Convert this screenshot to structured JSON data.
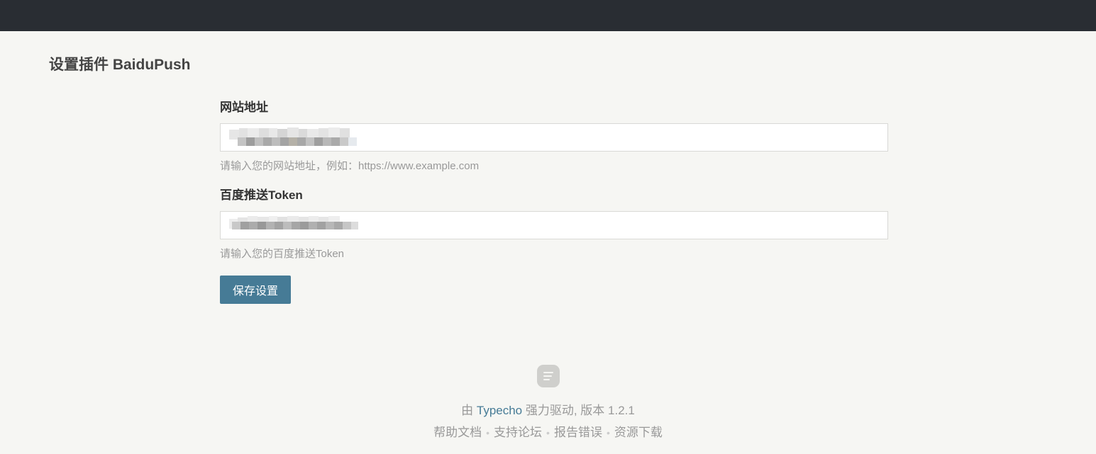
{
  "page_title": "设置插件 BaiduPush",
  "form": {
    "site_url": {
      "label": "网站地址",
      "value": "",
      "hint": "请输入您的网站地址，例如：https://www.example.com"
    },
    "token": {
      "label": "百度推送Token",
      "value": "",
      "hint": "请输入您的百度推送Token"
    },
    "save_label": "保存设置"
  },
  "footer": {
    "powered_prefix": "由 ",
    "powered_link": "Typecho",
    "powered_suffix": " 强力驱动, 版本 1.2.1",
    "links": [
      "帮助文档",
      "支持论坛",
      "报告错误",
      "资源下载"
    ],
    "separator": "•"
  },
  "colors": {
    "topbar": "#292d33",
    "background": "#f6f6f3",
    "accent": "#467b96"
  },
  "icons": {
    "footer_logo": "typecho-logo-icon"
  }
}
